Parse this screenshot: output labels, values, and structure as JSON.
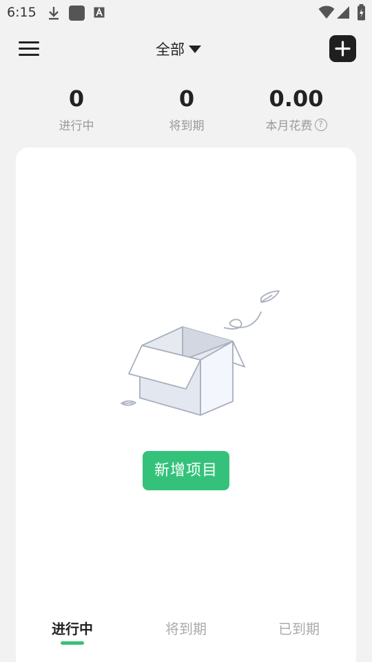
{
  "status_bar": {
    "time": "6:15",
    "icons": [
      "download-icon",
      "app-square-icon",
      "font-a-icon",
      "wifi-icon",
      "signal-icon",
      "battery-charging-icon"
    ]
  },
  "header": {
    "filter_label": "全部",
    "menu_icon": "hamburger-menu-icon",
    "add_icon": "plus-icon"
  },
  "stats": [
    {
      "value": "0",
      "label": "进行中"
    },
    {
      "value": "0",
      "label": "将到期"
    },
    {
      "value": "0.00",
      "label": "本月花费",
      "help": "?"
    }
  ],
  "empty_state": {
    "illustration": "open-box-illustration",
    "button_label": "新增项目"
  },
  "tabs": [
    {
      "label": "进行中",
      "active": true
    },
    {
      "label": "将到期",
      "active": false
    },
    {
      "label": "已到期",
      "active": false
    }
  ],
  "colors": {
    "accent": "#34c27a",
    "background": "#f2f2f2",
    "card": "#ffffff",
    "text_primary": "#222222",
    "text_secondary": "#999999"
  }
}
